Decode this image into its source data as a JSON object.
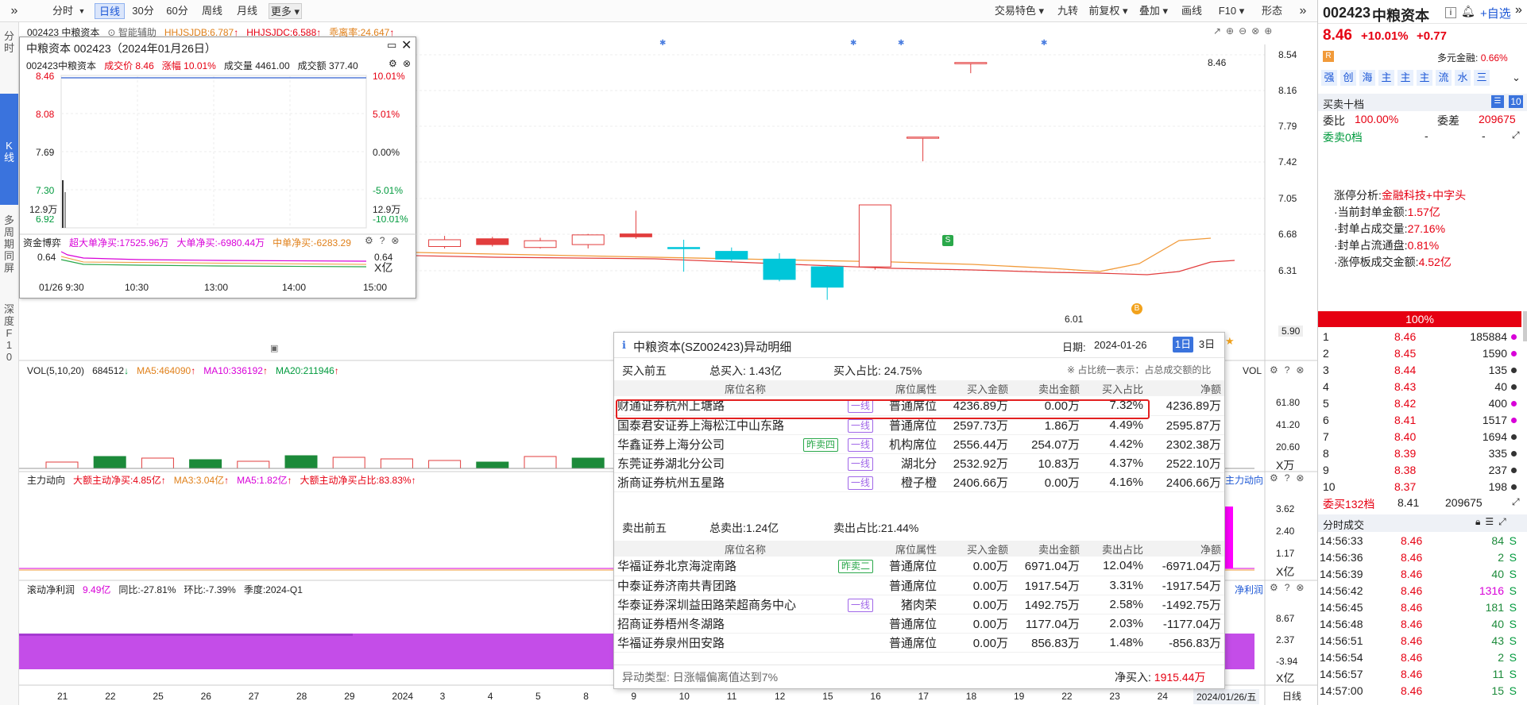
{
  "toolbar": {
    "periods": [
      "分时",
      "日线",
      "30分",
      "60分",
      "周线",
      "月线",
      "更多"
    ],
    "active": "日线",
    "right_tools": [
      "交易特色",
      "九转",
      "前复权",
      "叠加",
      "画线",
      "F10",
      "形态"
    ]
  },
  "leftnav": {
    "items": [
      "分时",
      "K线",
      "多周期同屏",
      "深度F10"
    ]
  },
  "chart": {
    "header": {
      "name": "002423 中粮资本",
      "assist": "智能辅助",
      "ind1": "HHJSJDB:6.787",
      "ind2": "HHJSJDC:6.588",
      "ind3": "乖离率:24.647"
    },
    "price_axis": [
      "8.54",
      "8.16",
      "7.79",
      "7.42",
      "7.05",
      "6.68",
      "6.31",
      "5.90"
    ],
    "high_label": "8.46",
    "low_label": "6.01",
    "vol_header": {
      "name": "VOL(5,10,20)",
      "value": "684512",
      "ma5": "MA5:464090",
      "ma10": "MA10:336192",
      "ma20": "MA20:211946"
    },
    "vol_axis": [
      "61.80",
      "41.20",
      "20.60",
      "X万"
    ],
    "vol_right": "VOL",
    "flow_header": {
      "name": "主力动向",
      "a": "大额主动净买:4.85亿",
      "b": "MA3:3.04亿",
      "c": "MA5:1.82亿",
      "d": "大额主动净买占比:83.83%"
    },
    "flow_axis": [
      "3.62",
      "2.40",
      "1.17",
      "X亿"
    ],
    "flow_right": "主力动向",
    "profit_header": {
      "name": "滚动净利润",
      "v": "9.49亿",
      "yoy": "同比:-27.81%",
      "qoq": "环比:-7.39%",
      "q": "季度:2024-Q1"
    },
    "profit_axis": [
      "8.67",
      "2.37",
      "-3.94",
      "X亿"
    ],
    "profit_right": "净利润",
    "x_labels": [
      "21",
      "22",
      "25",
      "26",
      "27",
      "28",
      "29",
      "2024",
      "3",
      "4",
      "5",
      "8",
      "9",
      "10",
      "11",
      "12",
      "15",
      "16",
      "17",
      "18",
      "19",
      "22",
      "23",
      "24"
    ],
    "cursor_date": "2024/01/26/五",
    "period_label": "日线",
    "chart_data": {
      "type": "candlestick",
      "candles": [
        {
          "o": 6.72,
          "c": 6.66,
          "h": 6.74,
          "l": 6.64
        },
        {
          "o": 6.72,
          "c": 6.68,
          "h": 6.76,
          "l": 6.66
        },
        {
          "o": 6.75,
          "c": 6.71,
          "h": 6.77,
          "l": 6.69
        },
        {
          "o": 6.7,
          "c": 6.64,
          "h": 6.78,
          "l": 6.62
        },
        {
          "o": 6.7,
          "c": 6.7,
          "h": 6.72,
          "l": 6.68
        },
        {
          "o": 6.68,
          "c": 6.55,
          "h": 6.7,
          "l": 6.54
        },
        {
          "o": 6.56,
          "c": 6.6,
          "h": 6.63,
          "l": 6.54
        },
        {
          "o": 6.56,
          "c": 6.59,
          "h": 6.64,
          "l": 6.55
        },
        {
          "o": 6.56,
          "c": 6.63,
          "h": 6.67,
          "l": 6.54
        },
        {
          "o": 6.64,
          "c": 6.58,
          "h": 6.66,
          "l": 6.56
        },
        {
          "o": 6.55,
          "c": 6.62,
          "h": 6.65,
          "l": 6.54
        },
        {
          "o": 6.58,
          "c": 6.68,
          "h": 6.69,
          "l": 6.54
        },
        {
          "o": 6.69,
          "c": 6.66,
          "h": 6.93,
          "l": 6.64
        },
        {
          "o": 6.55,
          "c": 6.55,
          "h": 6.63,
          "l": 6.3
        },
        {
          "o": 6.51,
          "c": 6.43,
          "h": 6.55,
          "l": 6.41
        },
        {
          "o": 6.43,
          "c": 6.22,
          "h": 6.49,
          "l": 6.2
        },
        {
          "o": 6.14,
          "c": 6.35,
          "h": 6.36,
          "l": 6.01
        },
        {
          "o": 6.35,
          "c": 6.99,
          "h": 6.99,
          "l": 6.32
        },
        {
          "o": 7.69,
          "c": 7.69,
          "h": 7.69,
          "l": 7.44
        },
        {
          "o": 8.46,
          "c": 8.46,
          "h": 8.46,
          "l": 8.35
        }
      ]
    }
  },
  "popup": {
    "title": "中粮资本 002423（2024年01月26日）",
    "row": {
      "code": "002423中粮资本",
      "price_lbl": "成交价",
      "price": "8.46",
      "chg_lbl": "涨幅",
      "chg": "10.01%",
      "vol_lbl": "成交量",
      "vol": "4461.00",
      "amt_lbl": "成交额",
      "amt": "377.40"
    },
    "left_axis": [
      "8.46",
      "8.08",
      "7.69",
      "7.30",
      "6.92",
      "12.9万"
    ],
    "right_axis": [
      "10.01%",
      "5.01%",
      "0.00%",
      "-5.01%",
      "-10.01%",
      "12.9万"
    ],
    "flow_label": "资金博弈",
    "flow_a": "超大单净买:17525.96万",
    "flow_b": "大单净买:-6980.44万",
    "flow_c": "中单净买:-6283.29",
    "flow_axis_l": "0.64",
    "flow_axis_r": "0.64",
    "flow_unit": "X亿",
    "times": [
      "01/26 9:30",
      "10:30",
      "13:00",
      "14:00",
      "15:00"
    ]
  },
  "lhb": {
    "title": "中粮资本(SZ002423)异动明细",
    "date_label": "日期:",
    "date": "2024-01-26",
    "tabs": [
      "1日",
      "3日"
    ],
    "buy_label": "买入前五",
    "buy_total": "总买入: 1.43亿",
    "buy_ratio": "买入占比: 24.75%",
    "note": "※ 占比统一表示：占总成交额的比",
    "columns": [
      "席位名称",
      "席位属性",
      "买入金额",
      "卖出金额",
      "买入占比",
      "净额"
    ],
    "buy_rows": [
      {
        "name": "财通证券杭州上塘路",
        "tag": "一线",
        "tag2": "",
        "attr": "普通席位",
        "buy": "4236.89万",
        "sell": "0.00万",
        "ratio": "7.32%",
        "net": "4236.89万"
      },
      {
        "name": "国泰君安证券上海松江中山东路",
        "tag": "一线",
        "tag2": "",
        "attr": "普通席位",
        "buy": "2597.73万",
        "sell": "1.86万",
        "ratio": "4.49%",
        "net": "2595.87万"
      },
      {
        "name": "华鑫证券上海分公司",
        "tag": "一线",
        "tag2": "昨卖四",
        "attr": "机构席位",
        "buy": "2556.44万",
        "sell": "254.07万",
        "ratio": "4.42%",
        "net": "2302.38万"
      },
      {
        "name": "东莞证券湖北分公司",
        "tag": "一线",
        "tag2": "",
        "attr": "湖北分",
        "buy": "2532.92万",
        "sell": "10.83万",
        "ratio": "4.37%",
        "net": "2522.10万"
      },
      {
        "name": "浙商证券杭州五星路",
        "tag": "一线",
        "tag2": "",
        "attr": "橙子橙",
        "buy": "2406.66万",
        "sell": "0.00万",
        "ratio": "4.16%",
        "net": "2406.66万"
      }
    ],
    "sell_label": "卖出前五",
    "sell_total": "总卖出:1.24亿",
    "sell_ratio": "卖出占比:21.44%",
    "sell_columns": [
      "席位名称",
      "席位属性",
      "买入金额",
      "卖出金额",
      "卖出占比",
      "净额"
    ],
    "sell_rows": [
      {
        "name": "华福证券北京海淀南路",
        "tag": "",
        "tag2": "昨卖二",
        "attr": "普通席位",
        "buy": "0.00万",
        "sell": "6971.04万",
        "ratio": "12.04%",
        "net": "-6971.04万"
      },
      {
        "name": "中泰证券济南共青团路",
        "tag": "",
        "tag2": "",
        "attr": "普通席位",
        "buy": "0.00万",
        "sell": "1917.54万",
        "ratio": "3.31%",
        "net": "-1917.54万"
      },
      {
        "name": "华泰证券深圳益田路荣超商务中心",
        "tag": "一线",
        "tag2": "",
        "attr": "猪肉荣",
        "buy": "0.00万",
        "sell": "1492.75万",
        "ratio": "2.58%",
        "net": "-1492.75万"
      },
      {
        "name": "招商证券梧州冬湖路",
        "tag": "",
        "tag2": "",
        "attr": "普通席位",
        "buy": "0.00万",
        "sell": "1177.04万",
        "ratio": "2.03%",
        "net": "-1177.04万"
      },
      {
        "name": "华福证券泉州田安路",
        "tag": "",
        "tag2": "",
        "attr": "普通席位",
        "buy": "0.00万",
        "sell": "856.83万",
        "ratio": "1.48%",
        "net": "-856.83万"
      }
    ],
    "footer_type": "异动类型: 日涨幅偏离值达到7%",
    "footer_net_lbl": "净买入:",
    "footer_net": "1915.44万"
  },
  "quote": {
    "code": "002423",
    "name": "中粮资本",
    "price": "8.46",
    "chg_pct": "+10.01%",
    "chg": "+0.77",
    "add_btn": "自选",
    "margin_label": "多元金融:",
    "margin": "0.66%",
    "r_badge": "R",
    "tags": [
      "强",
      "创",
      "海",
      "主",
      "主",
      "主",
      "流",
      "水",
      "三"
    ],
    "ob_title": "买卖十档",
    "ob_num": "10",
    "webi_lbl": "委比",
    "webi": "100.00%",
    "weicha_lbl": "委差",
    "weicha": "209675",
    "sell0": "委卖0档",
    "dash1": "-",
    "dash2": "-",
    "analysis": [
      {
        "k": "涨停分析:",
        "v": "金融科技+中字头"
      },
      {
        "k": "·当前封单金额:",
        "v": "1.57亿"
      },
      {
        "k": "·封单占成交量:",
        "v": "27.16%"
      },
      {
        "k": "·封单占流通盘:",
        "v": "0.81%"
      },
      {
        "k": "·涨停板成交金额:",
        "v": "4.52亿"
      }
    ],
    "bar": "100%",
    "bids": [
      {
        "n": "1",
        "p": "8.46",
        "v": "185884",
        "dot": "#d800d8"
      },
      {
        "n": "2",
        "p": "8.45",
        "v": "1590",
        "dot": "#d800d8"
      },
      {
        "n": "3",
        "p": "8.44",
        "v": "135",
        "dot": "#333"
      },
      {
        "n": "4",
        "p": "8.43",
        "v": "40",
        "dot": "#333"
      },
      {
        "n": "5",
        "p": "8.42",
        "v": "400",
        "dot": "#d800d8"
      },
      {
        "n": "6",
        "p": "8.41",
        "v": "1517",
        "dot": "#d800d8"
      },
      {
        "n": "7",
        "p": "8.40",
        "v": "1694",
        "dot": "#333"
      },
      {
        "n": "8",
        "p": "8.39",
        "v": "335",
        "dot": "#333"
      },
      {
        "n": "9",
        "p": "8.38",
        "v": "237",
        "dot": "#333"
      },
      {
        "n": "10",
        "p": "8.37",
        "v": "198",
        "dot": "#333"
      }
    ],
    "buy_sum_lbl": "委买132档",
    "buy_sum_p": "8.41",
    "buy_sum_v": "209675",
    "tick_title": "分时成交",
    "ticks": [
      {
        "t": "14:56:33",
        "p": "8.46",
        "v": "84",
        "s": "S"
      },
      {
        "t": "14:56:36",
        "p": "8.46",
        "v": "2",
        "s": "S"
      },
      {
        "t": "14:56:39",
        "p": "8.46",
        "v": "40",
        "s": "S"
      },
      {
        "t": "14:56:42",
        "p": "8.46",
        "v": "1316",
        "s": "S"
      },
      {
        "t": "14:56:45",
        "p": "8.46",
        "v": "181",
        "s": "S"
      },
      {
        "t": "14:56:48",
        "p": "8.46",
        "v": "40",
        "s": "S"
      },
      {
        "t": "14:56:51",
        "p": "8.46",
        "v": "43",
        "s": "S"
      },
      {
        "t": "14:56:54",
        "p": "8.46",
        "v": "2",
        "s": "S"
      },
      {
        "t": "14:56:57",
        "p": "8.46",
        "v": "11",
        "s": "S"
      },
      {
        "t": "14:57:00",
        "p": "8.46",
        "v": "15",
        "s": "S"
      }
    ]
  }
}
